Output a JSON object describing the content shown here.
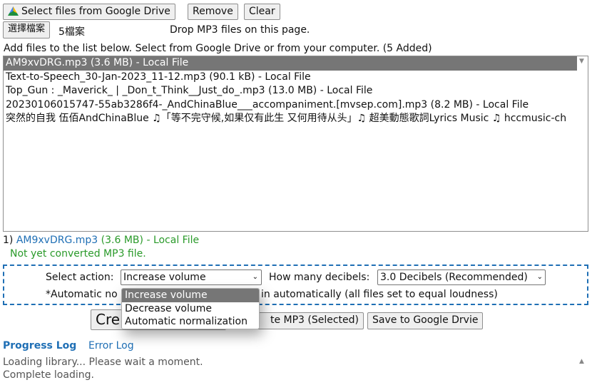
{
  "toolbar": {
    "google_drive": "Select files from Google Drive",
    "remove": "Remove",
    "clear": "Clear",
    "choose_file": "選擇檔案",
    "file_count": "5檔案",
    "drop_hint": "Drop MP3 files on this page."
  },
  "instructions": "Add files to the list below. Select from Google Drive or from your computer. (5 Added)",
  "files": [
    "AM9xvDRG.mp3 (3.6 MB) - Local File",
    "Text-to-Speech_30-Jan-2023_11-12.mp3 (90.1 kB) - Local File",
    "Top_Gun : _Maverick_ | _Don_t_Think__Just_do_.mp3 (13.0 MB) - Local File",
    "20230106015747-55ab3286f4-_AndChinaBlue___accompaniment.[mvsep.com].mp3 (8.2 MB) - Local File",
    "突然的自我 伍佰AndChinaBlue ♫「等不完守候,如果仅有此生 又何用待从头」♫ 超美動態歌詞Lyrics Music ♫ hccmusic-ch"
  ],
  "selected": {
    "index": "1)",
    "name": "AM9xvDRG.mp3",
    "size": "(3.6 MB)",
    "source": "- Local File",
    "status": "Not yet converted MP3 file."
  },
  "options": {
    "action_label": "Select action:",
    "action_value": "Increase volume",
    "action_options": [
      "Increase volume",
      "Decrease volume",
      "Automatic normalization"
    ],
    "db_label": "How many decibels:",
    "db_value": "3.0 Decibels (Recommended)",
    "note_start": "*Automatic no",
    "note_end": "in automatically (all files set to equal loudness)"
  },
  "actions": {
    "create_all": "Cre",
    "create_selected": "te MP3 (Selected)",
    "save_drive": "Save to Google Drvie"
  },
  "logs": {
    "tab_progress": "Progress Log",
    "tab_error": "Error Log",
    "lines": [
      "Loading library... Please wait a moment.",
      "Complete loading."
    ]
  },
  "colors": {
    "link": "#1f6fb5",
    "green": "#2a9a2a",
    "selected_bg": "#767676"
  }
}
